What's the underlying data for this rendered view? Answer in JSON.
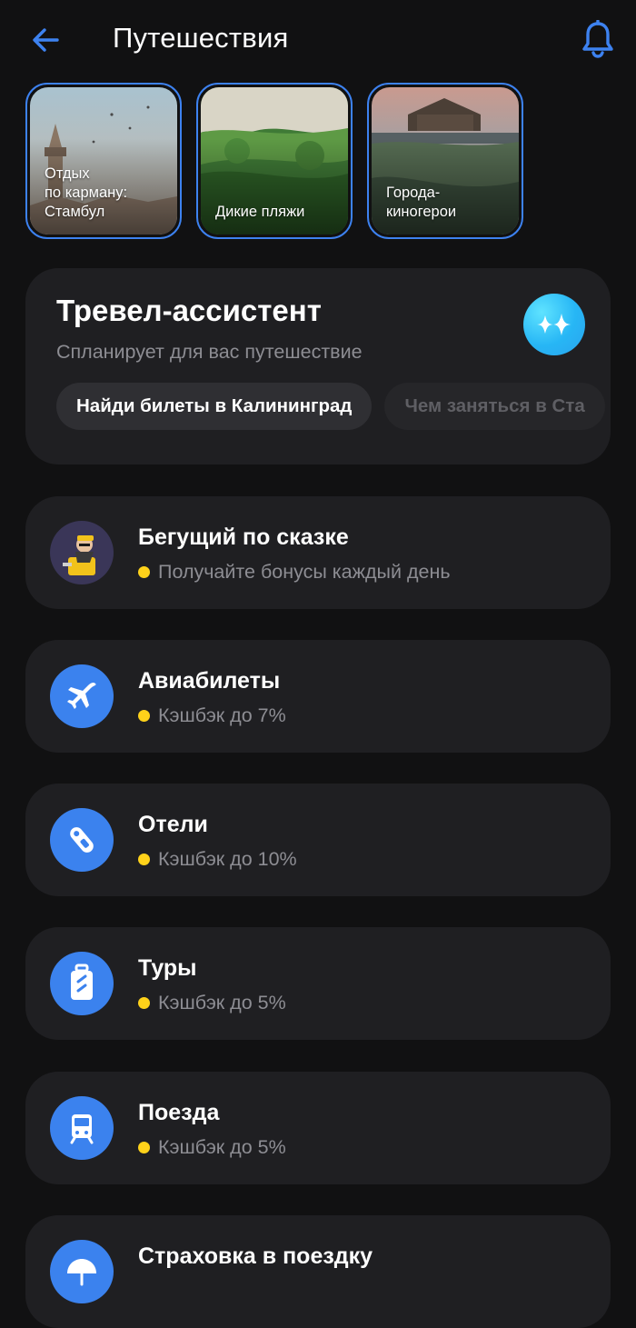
{
  "header": {
    "title": "Путешествия",
    "back_icon": "arrow-left-icon",
    "bell_icon": "bell-icon",
    "accent_color": "#3d82f0"
  },
  "stories": [
    {
      "label": "Отдых\nпо карману:\nСтамбул"
    },
    {
      "label": "Дикие пляжи"
    },
    {
      "label": "Города-\nкиногерои"
    }
  ],
  "assistant": {
    "title": "Тревел-ассистент",
    "subtitle": "Спланирует для вас путешествие",
    "icon": "sparkle-icon",
    "chips": [
      "Найди билеты в Калининград",
      "Чем заняться в Ста"
    ]
  },
  "services": [
    {
      "title": "Бегущий по сказке",
      "subtitle": "Получайте бонусы каждый день",
      "icon": "runner-avatar-icon"
    },
    {
      "title": "Авиабилеты",
      "subtitle": "Кэшбэк до 7%",
      "icon": "airplane-icon"
    },
    {
      "title": "Отели",
      "subtitle": "Кэшбэк до 10%",
      "icon": "door-hanger-icon"
    },
    {
      "title": "Туры",
      "subtitle": "Кэшбэк до 5%",
      "icon": "suitcase-icon"
    },
    {
      "title": "Поезда",
      "subtitle": "Кэшбэк до 5%",
      "icon": "train-icon"
    },
    {
      "title": "Страховка в поездку",
      "subtitle": "",
      "icon": "umbrella-icon"
    }
  ],
  "colors": {
    "background": "#111112",
    "card": "#1f1f22",
    "accent_blue": "#3b82ee",
    "bonus_dot": "#ffd21a",
    "muted_text": "#8d8d93"
  }
}
